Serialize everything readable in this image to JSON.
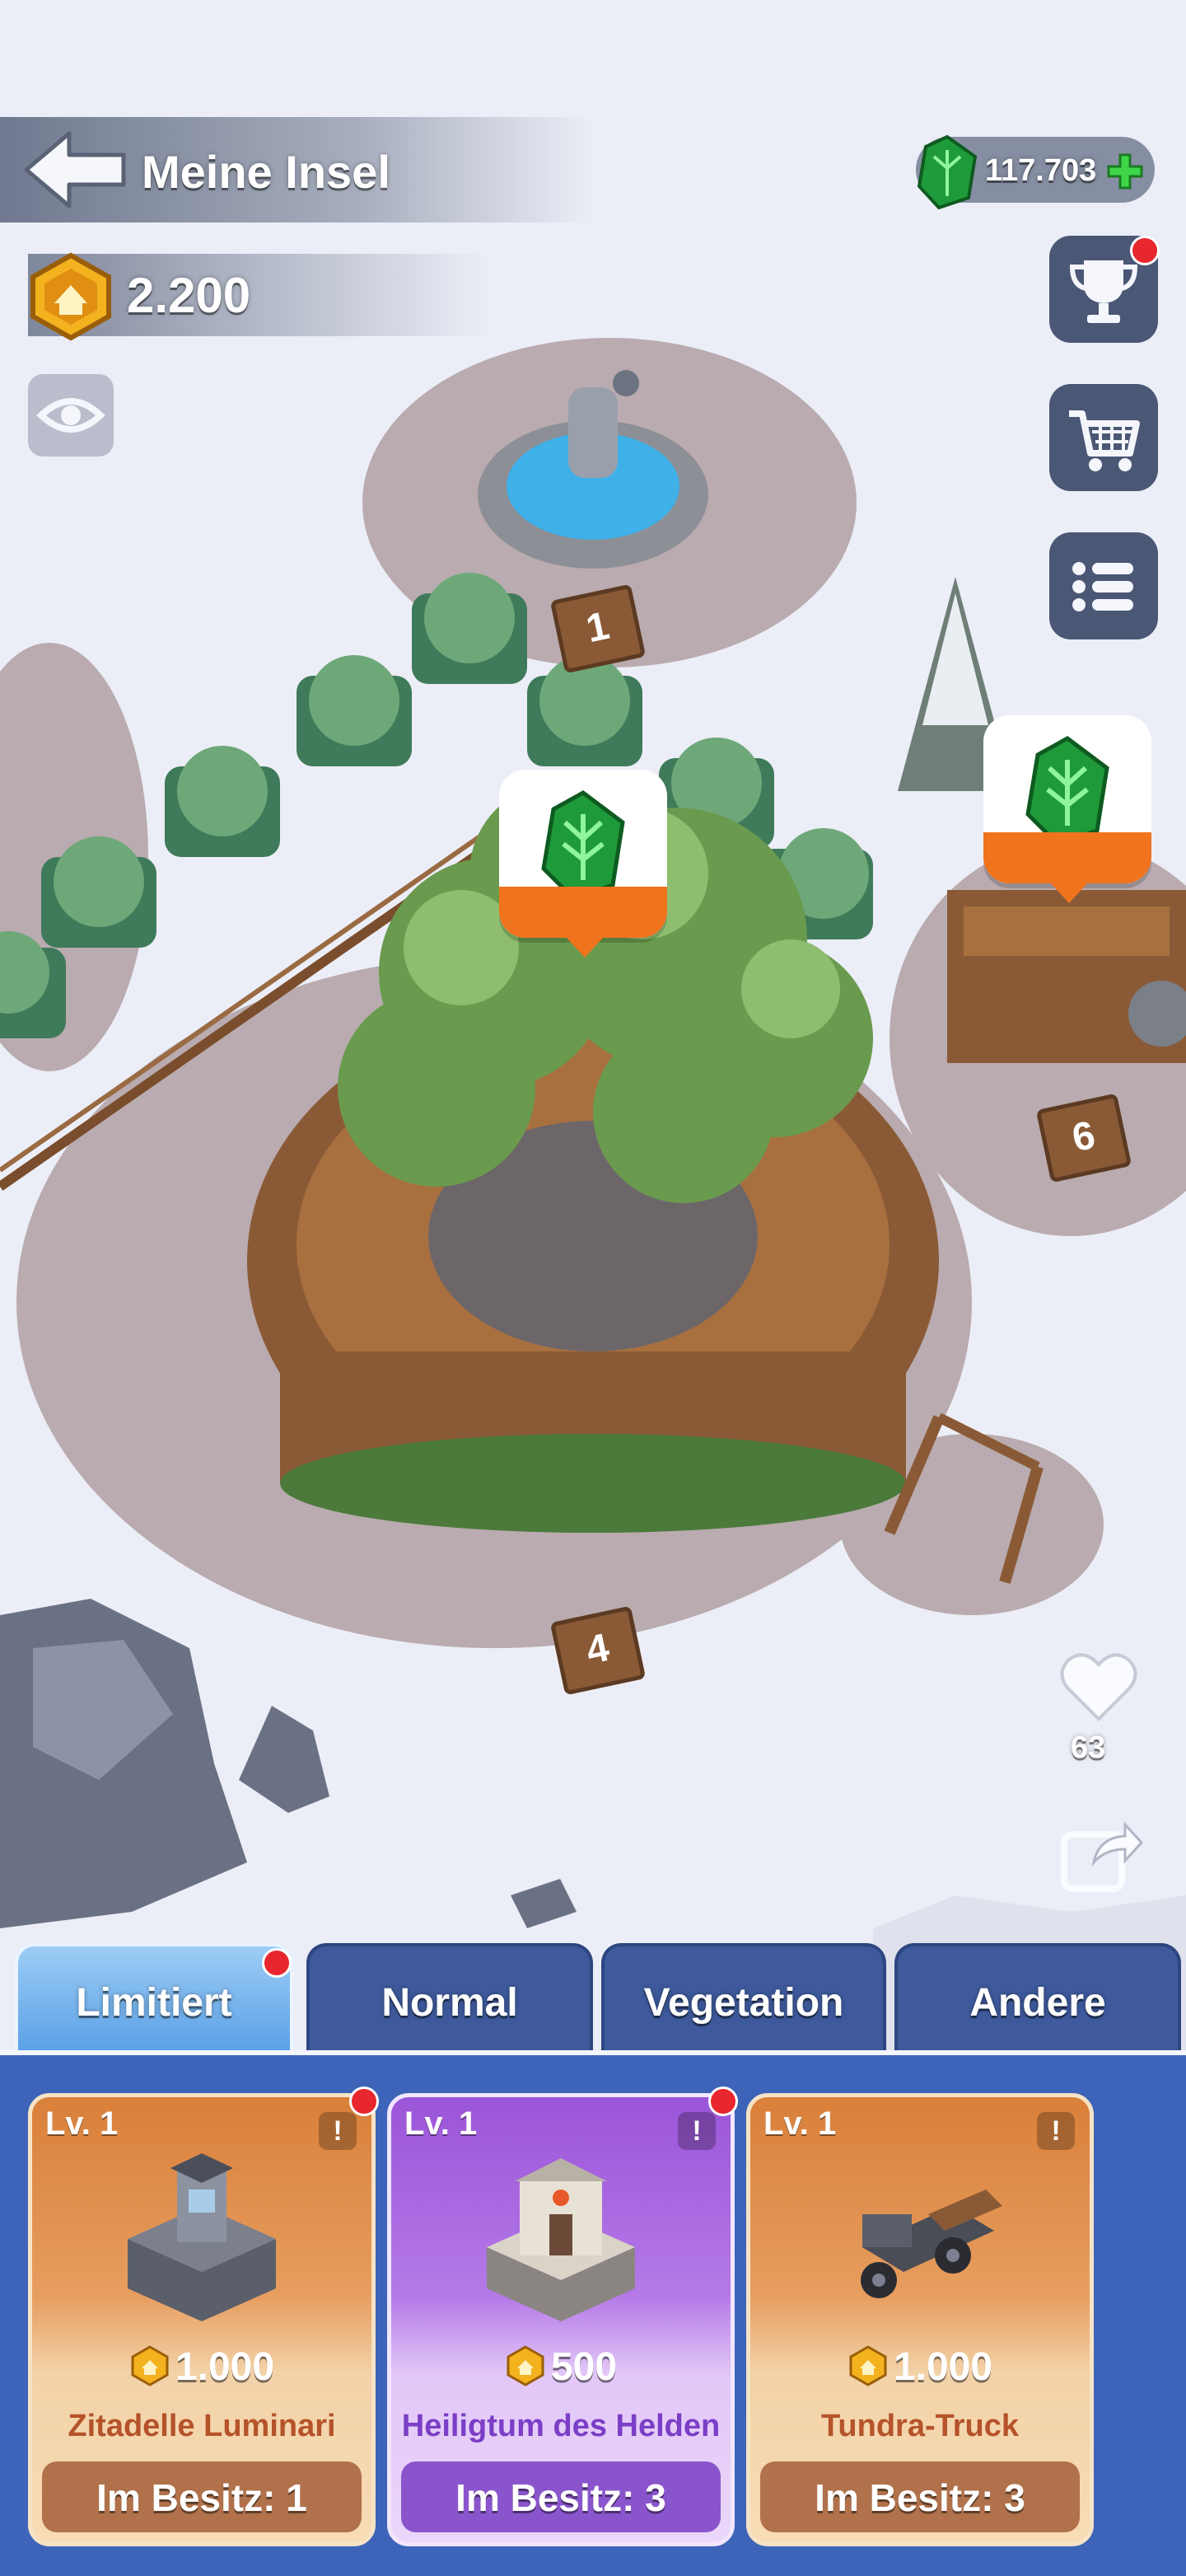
{
  "header": {
    "title": "Meine Insel",
    "coins": "2.200",
    "gems": "117.703"
  },
  "map": {
    "plot_labels": [
      "1",
      "6",
      "4"
    ]
  },
  "social": {
    "likes": "63"
  },
  "tabs": [
    {
      "label": "Limitiert",
      "active": true,
      "has_notification": true
    },
    {
      "label": "Normal",
      "active": false
    },
    {
      "label": "Vegetation",
      "active": false
    },
    {
      "label": "Andere",
      "active": false
    }
  ],
  "cards": [
    {
      "level": "Lv. 1",
      "price": "1.000",
      "name": "Zitadelle Luminari",
      "owned": "Im Besitz: 1",
      "rarity_color": "#d9803a",
      "has_notification": true
    },
    {
      "level": "Lv. 1",
      "price": "500",
      "name": "Heiligtum des Helden",
      "owned": "Im Besitz: 3",
      "rarity_color": "#9b55d8",
      "has_notification": true
    },
    {
      "level": "Lv. 1",
      "price": "1.000",
      "name": "Tundra-Truck",
      "owned": "Im Besitz: 3",
      "rarity_color": "#d9803a",
      "has_notification": false
    }
  ],
  "icons": {
    "info": "!",
    "back": "back-arrow-icon",
    "trophy": "trophy-icon",
    "shop": "cart-icon",
    "menu": "list-icon",
    "heart": "heart-icon",
    "share": "share-icon",
    "eye": "eye-icon"
  }
}
